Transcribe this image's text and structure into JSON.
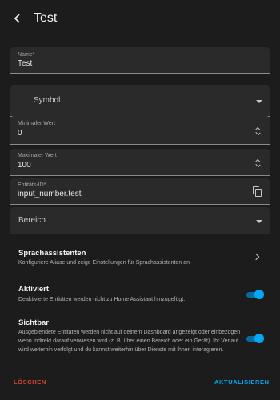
{
  "header": {
    "back_icon": "back-arrow-icon",
    "title": "Test"
  },
  "form": {
    "name": {
      "label": "Name*",
      "value": "Test"
    },
    "symbol": {
      "placeholder": "Symbol"
    },
    "min": {
      "label": "Minimaler Wert",
      "value": "0"
    },
    "max": {
      "label": "Maximaler Wert",
      "value": "100"
    },
    "entity_id": {
      "label": "Entitäts-ID*",
      "value": "input_number.test"
    },
    "area": {
      "placeholder": "Bereich"
    }
  },
  "settings": {
    "voice": {
      "title": "Sprachassistenten",
      "description": "Konfiguriere Aliase und zeige Einstellungen für Sprachassistenten an"
    },
    "enabled": {
      "title": "Aktiviert",
      "description": "Deaktivierte Entitäten werden nicht zu Home Assistant hinzugefügt.",
      "on": true
    },
    "visible": {
      "title": "Sichtbar",
      "description": "Ausgeblendete Entitäten werden nicht auf deinem Dashboard angezeigt oder einbezogen wenn indirekt darauf verwiesen wird (z. B. über einen Bereich oder ein Gerät). Ihr Verlauf wird weiterhin verfolgt und du kannst weiterhin über Dienste mit ihnen interagieren.",
      "on": true
    }
  },
  "footer": {
    "delete_label": "LÖSCHEN",
    "update_label": "AKTUALISIEREN"
  },
  "colors": {
    "accent": "#03a9f4",
    "danger": "#db4437",
    "background": "#1c1c1c",
    "field": "#2a2a2a"
  }
}
